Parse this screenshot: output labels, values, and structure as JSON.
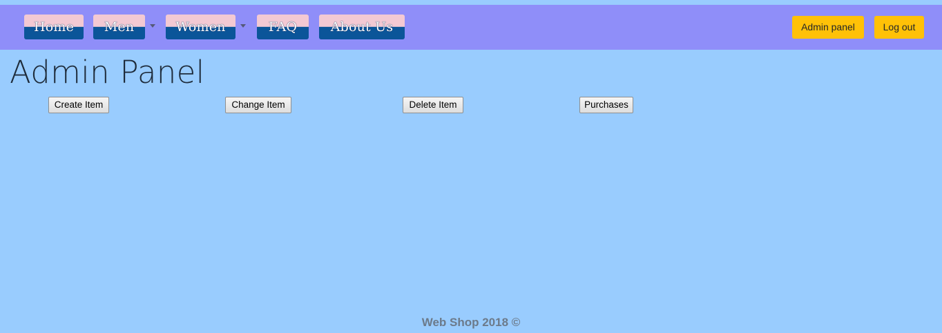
{
  "nav": {
    "items": [
      {
        "label": "Home",
        "has_dropdown": false
      },
      {
        "label": "Men",
        "has_dropdown": true
      },
      {
        "label": "Women",
        "has_dropdown": true
      },
      {
        "label": "FAQ",
        "has_dropdown": false
      },
      {
        "label": "About Us",
        "has_dropdown": false
      }
    ],
    "admin_panel_label": "Admin panel",
    "logout_label": "Log out"
  },
  "main": {
    "title": "Admin Panel",
    "buttons": [
      {
        "label": "Create Item"
      },
      {
        "label": "Change Item"
      },
      {
        "label": "Delete Item"
      },
      {
        "label": "Purchases"
      }
    ]
  },
  "footer": {
    "text": "Web Shop 2018 ©"
  },
  "colors": {
    "background": "#99ccfe",
    "navbar": "#8f8ef9",
    "nav_button_top": "#f3c9d3",
    "nav_button_bottom": "#0b5599",
    "action_button": "#ffc107"
  }
}
